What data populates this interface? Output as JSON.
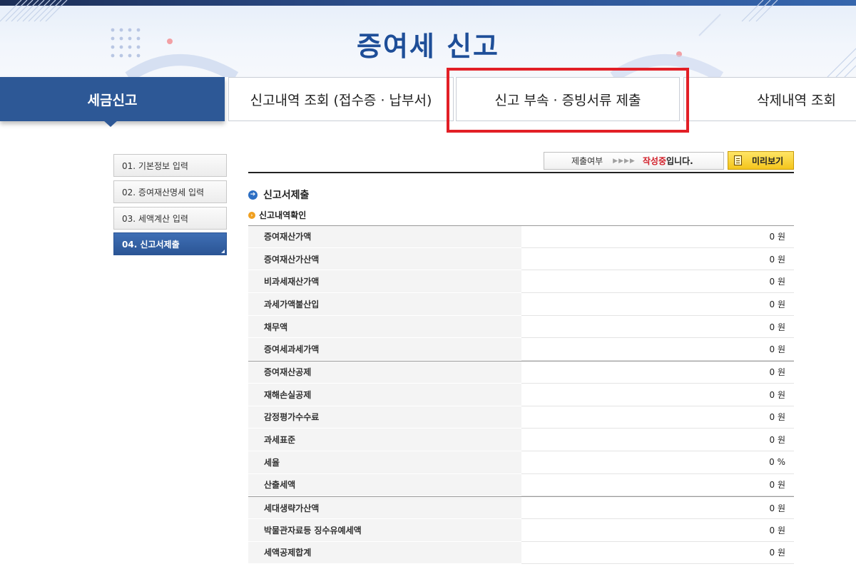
{
  "banner": {
    "title": "증여세 신고"
  },
  "tabs": [
    {
      "label": "세금신고",
      "active": true
    },
    {
      "label": "신고내역 조회 (접수증 · 납부서)",
      "active": false
    },
    {
      "label": "신고 부속 · 증빙서류 제출",
      "active": false,
      "highlighted": true
    },
    {
      "label": "삭제내역 조회",
      "active": false
    }
  ],
  "steps": [
    {
      "label": "01. 기본정보 입력",
      "active": false
    },
    {
      "label": "02. 증여재산명세 입력",
      "active": false
    },
    {
      "label": "03. 세액계산 입력",
      "active": false
    },
    {
      "label": "04. 신고서제출",
      "active": true
    }
  ],
  "status": {
    "label": "제출여부",
    "arrows": "▶▶▶▶",
    "value_red": "작성중",
    "value_suffix": "입니다.",
    "preview_label": "미리보기"
  },
  "section": {
    "title": "신고서제출",
    "subtitle": "신고내역확인"
  },
  "table": {
    "rows": [
      {
        "label": "증여재산가액",
        "value": "0 원"
      },
      {
        "label": "증여재산가산액",
        "value": "0 원"
      },
      {
        "label": "비과세재산가액",
        "value": "0 원"
      },
      {
        "label": "과세가액불산입",
        "value": "0 원"
      },
      {
        "label": "채무액",
        "value": "0 원"
      },
      {
        "label": "증여세과세가액",
        "value": "0 원"
      },
      {
        "label": "증여재산공제",
        "value": "0 원"
      },
      {
        "label": "재해손실공제",
        "value": "0 원"
      },
      {
        "label": "감정평가수수료",
        "value": "0 원"
      },
      {
        "label": "과세표준",
        "value": "0 원"
      },
      {
        "label": "세율",
        "value": "0 %"
      },
      {
        "label": "산출세액",
        "value": "0 원"
      },
      {
        "label": "세대생략가산액",
        "value": "0 원"
      },
      {
        "label": "박물관자료등 징수유예세액",
        "value": "0 원"
      },
      {
        "label": "세액공제합계",
        "value": "0 원"
      }
    ]
  },
  "colors": {
    "tab_active": "#2d5896",
    "title_blue": "#1e4e98",
    "highlight_red": "#e21f26",
    "status_red": "#d2202a",
    "preview_yellow": "#f4c51c"
  }
}
